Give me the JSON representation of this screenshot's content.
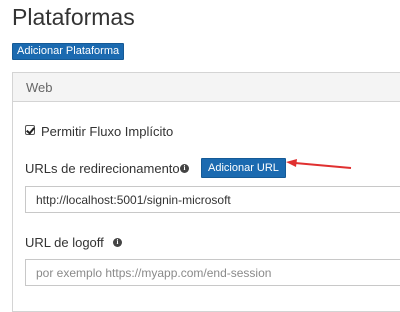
{
  "page": {
    "title": "Plataformas"
  },
  "toolbar": {
    "add_platform_label": "Adicionar Plataforma"
  },
  "panel": {
    "header": "Web",
    "implicit_flow": {
      "label": "Permitir Fluxo Implícito",
      "checked": true
    },
    "redirect_urls": {
      "label": "URLs de redirecionamento",
      "info_icon": "info-icon",
      "add_button_label": "Adicionar URL",
      "value": "http://localhost:5001/signin-microsoft"
    },
    "logout_url": {
      "label": "URL de logoff",
      "info_icon": "info-icon",
      "placeholder": "por exemplo https://myapp.com/end-session",
      "value": ""
    }
  },
  "annotation": {
    "arrow_color": "#e03030"
  },
  "colors": {
    "accent": "#1b6ab0"
  }
}
